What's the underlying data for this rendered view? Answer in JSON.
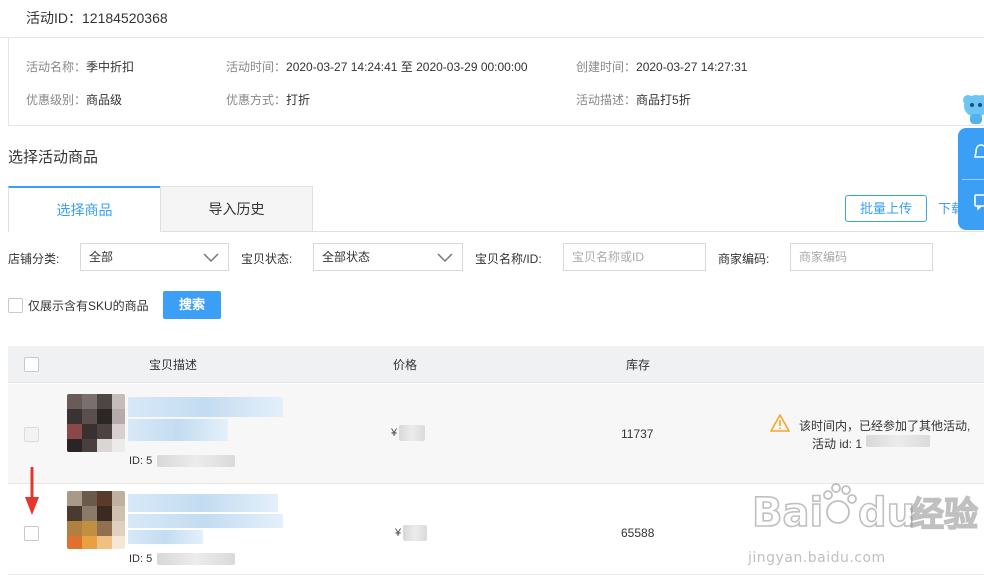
{
  "activity_id": "活动ID：12184520368",
  "info": {
    "name_label": "活动名称：",
    "name_value": "季中折扣",
    "time_label": "活动时间：",
    "time_value": "2020-03-27 14:24:41 至 2020-03-29 00:00:00",
    "created_label": "创建时间：",
    "created_value": "2020-03-27 14:27:31",
    "level_label": "优惠级别：",
    "level_value": "商品级",
    "method_label": "优惠方式：",
    "method_value": "打折",
    "desc_label": "活动描述：",
    "desc_value": "商品打5折"
  },
  "section_title": "选择活动商品",
  "tabs": [
    {
      "label": "选择商品",
      "active": true
    },
    {
      "label": "导入历史",
      "active": false
    }
  ],
  "actions": {
    "batch_upload": "批量上传",
    "download_partial": "下载"
  },
  "filters": {
    "shop_category_label": "店铺分类:",
    "shop_category_value": "全部",
    "item_status_label": "宝贝状态:",
    "item_status_value": "全部状态",
    "item_name_label": "宝贝名称/ID:",
    "item_name_placeholder": "宝贝名称或ID",
    "merchant_code_label": "商家编码:",
    "merchant_code_placeholder": "商家编码",
    "sku_only_label": "仅展示含有SKU的商品",
    "search_button": "搜索"
  },
  "table": {
    "columns": [
      "宝贝描述",
      "价格",
      "库存"
    ],
    "rows": [
      {
        "id_prefix": "ID: 5",
        "price_prefix": "¥",
        "stock": "11737",
        "warning_line1": "该时间内，已经参加了其他活动,",
        "warning_line2": "活动 id: 1",
        "disabled": true
      },
      {
        "id_prefix": "ID: 5",
        "price_prefix": "¥",
        "stock": "65588",
        "disabled": false
      }
    ]
  },
  "watermark": {
    "brand": "Baidu经验",
    "url": "jingyan.baidu.com"
  },
  "colors": {
    "accent": "#3a9ff5",
    "warning": "#f5a623",
    "annotation_arrow": "#e8342c"
  }
}
